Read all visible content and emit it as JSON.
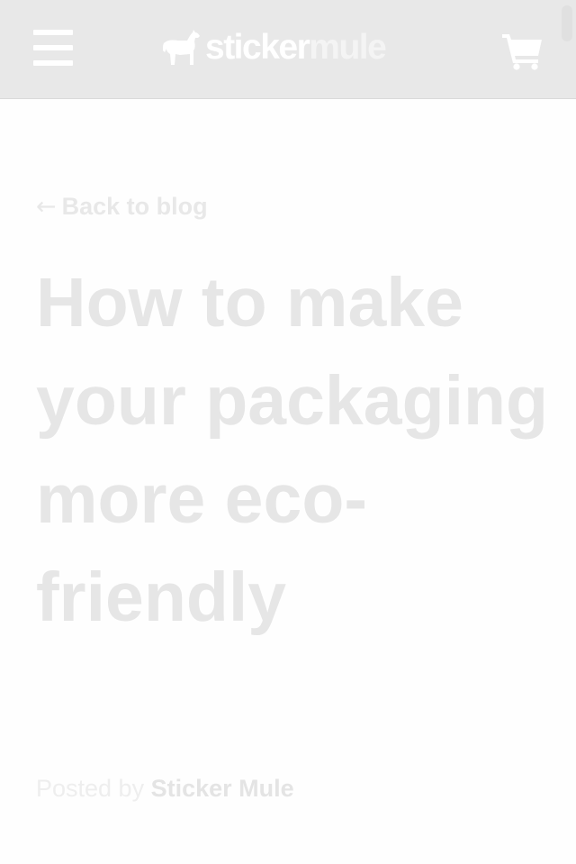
{
  "header": {
    "menu_icon": "hamburger-menu-icon",
    "logo": {
      "icon": "mule-icon",
      "part1": "sticker",
      "part2": "mule"
    },
    "cart_icon": "shopping-cart-icon"
  },
  "article": {
    "back_arrow": "←",
    "back_label": "Back to blog",
    "title": "How to make your packaging more eco-friendly",
    "byline_prefix": "Posted by ",
    "author": "Sticker Mule"
  },
  "colors": {
    "header_bg": "#e8e8e8",
    "title": "#e6e6e6",
    "page_bg": "#fefefe"
  }
}
